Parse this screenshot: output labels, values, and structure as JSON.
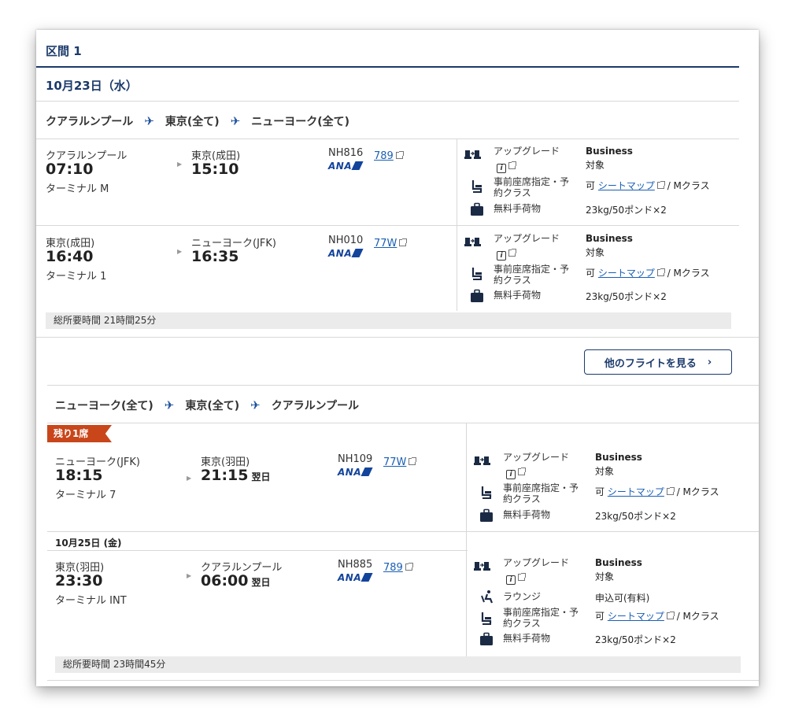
{
  "section": {
    "title": "区間 1",
    "date": "10月23日（水）"
  },
  "icons": {
    "plane": "airplane-icon",
    "upgrade": "seats-upgrade-icon",
    "seat": "seat-icon",
    "baggage": "baggage-icon",
    "lounge": "lounge-icon",
    "external": "external-link-icon",
    "info": "info-icon"
  },
  "colors": {
    "navy": "#1b3a6b",
    "link": "#1a5fb4",
    "badge": "#c8461a"
  },
  "labels": {
    "upgrade": "アップグレード",
    "seat": "事前座席指定・予約クラス",
    "seat_l1": "事前座席指定・予",
    "seat_l2": "約クラス",
    "baggage": "無料手荷物",
    "lounge": "ラウンジ",
    "seatmap": "シートマップ",
    "airline": "ANA"
  },
  "route1": {
    "from": "クアラルンプール",
    "via": "東京(全て)",
    "to": "ニューヨーク(全て)"
  },
  "route2": {
    "from": "ニューヨーク(全て)",
    "via": "東京(全て)",
    "to": "クアラルンプール"
  },
  "flights": [
    {
      "dep_city": "クアラルンプール",
      "dep_time": "07:10",
      "dep_term": "ターミナル M",
      "arr_city": "東京(成田)",
      "arr_time": "15:10",
      "arr_next": "",
      "flight": "NH816",
      "aircraft": "789",
      "upgrade_val": "Business",
      "upgrade_sub": "対象",
      "seat_prefix": "可",
      "seat_class": "/ Mクラス",
      "baggage_val": "23kg/50ポンド×2"
    },
    {
      "dep_city": "東京(成田)",
      "dep_time": "16:40",
      "dep_term": "ターミナル 1",
      "arr_city": "ニューヨーク(JFK)",
      "arr_time": "16:35",
      "arr_next": "",
      "flight": "NH010",
      "aircraft": "77W",
      "upgrade_val": "Business",
      "upgrade_sub": "対象",
      "seat_prefix": "可",
      "seat_class": "/ Mクラス",
      "baggage_val": "23kg/50ポンド×2"
    },
    {
      "dep_city": "ニューヨーク(JFK)",
      "dep_time": "18:15",
      "dep_term": "ターミナル 7",
      "arr_city": "東京(羽田)",
      "arr_time": "21:15",
      "arr_next": "翌日",
      "flight": "NH109",
      "aircraft": "77W",
      "upgrade_val": "Business",
      "upgrade_sub": "対象",
      "seat_prefix": "可",
      "seat_class": "/ Mクラス",
      "baggage_val": "23kg/50ポンド×2"
    },
    {
      "dep_city": "東京(羽田)",
      "dep_time": "23:30",
      "dep_term": "ターミナル INT",
      "arr_city": "クアラルンプール",
      "arr_time": "06:00",
      "arr_next": "翌日",
      "flight": "NH885",
      "aircraft": "789",
      "upgrade_val": "Business",
      "upgrade_sub": "対象",
      "lounge_val": "申込可(有料)",
      "seat_prefix": "可",
      "seat_class": "/ Mクラス",
      "baggage_val": "23kg/50ポンド×2"
    }
  ],
  "total1": "総所要時間 21時間25分",
  "total2": "総所要時間 23時間45分",
  "more_button": "他のフライトを見る",
  "badge": "残り1席",
  "date2": "10月25日 (金)"
}
